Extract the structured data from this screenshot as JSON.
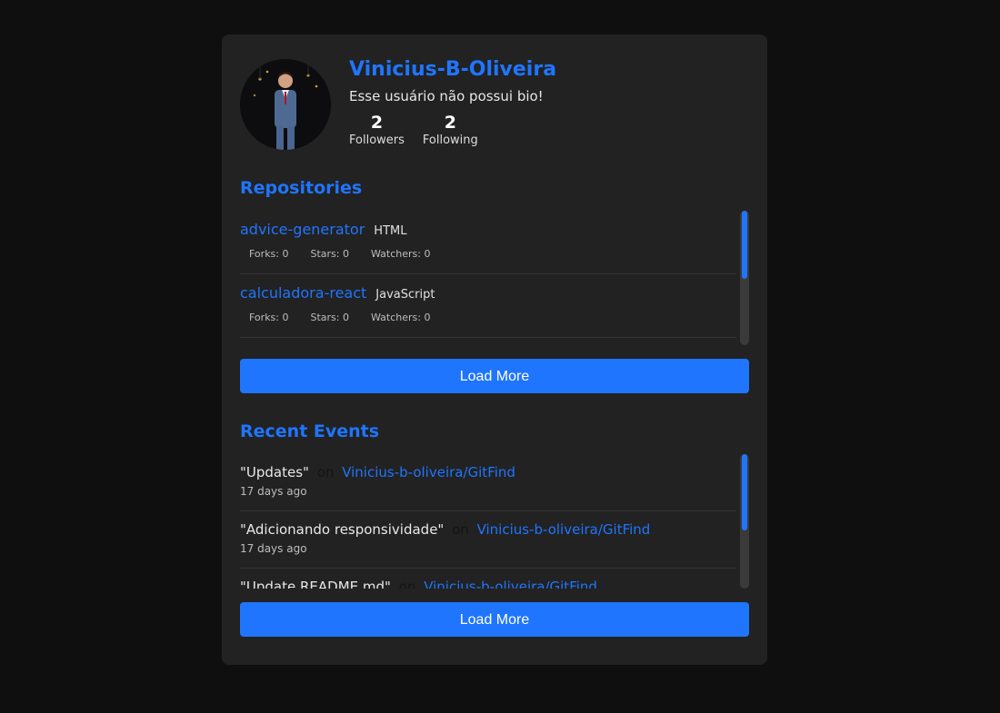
{
  "profile": {
    "username": "Vinicius-B-Oliveira",
    "bio": "Esse usuário não possui bio!",
    "followers_count": "2",
    "followers_label": "Followers",
    "following_count": "2",
    "following_label": "Following"
  },
  "repositories": {
    "title": "Repositories",
    "items": [
      {
        "name": "advice-generator",
        "language": "HTML",
        "forks": "Forks: 0",
        "stars": "Stars: 0",
        "watchers": "Watchers: 0"
      },
      {
        "name": "calculadora-react",
        "language": "JavaScript",
        "forks": "Forks: 0",
        "stars": "Stars: 0",
        "watchers": "Watchers: 0"
      }
    ],
    "scroll_fraction": 0.51,
    "load_more_label": "Load More"
  },
  "events": {
    "title": "Recent Events",
    "connector": "on",
    "items": [
      {
        "message": "\"Updates\"",
        "repo": "Vinicius-b-oliveira/GitFind",
        "time": "17 days ago"
      },
      {
        "message": "\"Adicionando responsividade\"",
        "repo": "Vinicius-b-oliveira/GitFind",
        "time": "17 days ago"
      },
      {
        "message": "\"Update README.md\"",
        "repo": "Vinicius-b-oliveira/GitFind",
        "time": ""
      }
    ],
    "scroll_fraction": 0.57,
    "load_more_label": "Load More"
  },
  "colors": {
    "accent": "#1f75fe",
    "card_bg": "#222222",
    "page_bg": "#0f0f0f"
  }
}
